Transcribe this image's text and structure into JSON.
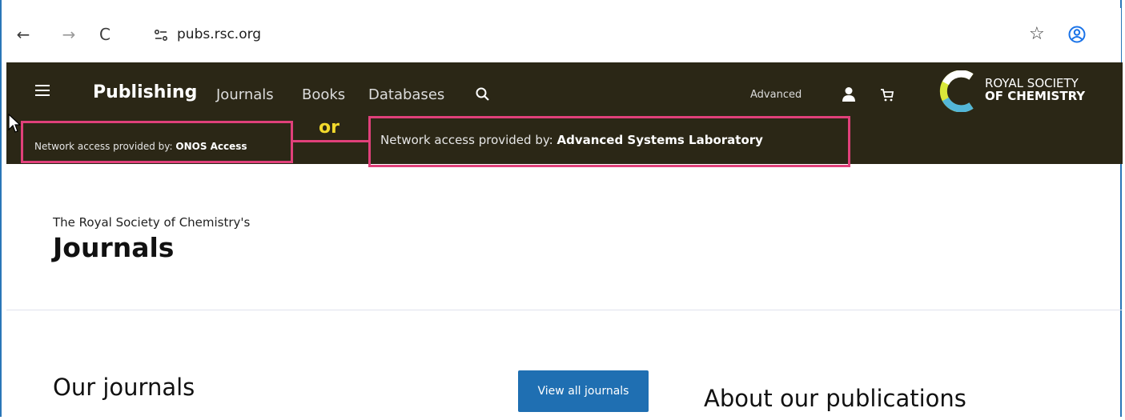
{
  "browser": {
    "back_icon": "arrow-left-icon",
    "forward_icon": "arrow-right-icon",
    "reload_icon": "reload-icon",
    "url": "pubs.rsc.org"
  },
  "header": {
    "brand": "Publishing",
    "nav": [
      "Journals",
      "Books",
      "Databases"
    ],
    "advanced": "Advanced",
    "logo_line1": "ROYAL SOCIETY",
    "logo_line2": "OF CHEMISTRY",
    "background_color": "#2b2716",
    "access_1_prefix": "Network access provided by: ",
    "access_1_name": "ONOS Access",
    "access_2_prefix": "Network access provided by: ",
    "access_2_name": "Advanced Systems Laboratory",
    "or_label": "or",
    "highlight_color": "#e0407a"
  },
  "main": {
    "intro_small": "The Royal Society of Chemistry's",
    "intro_title": "Journals",
    "our_journals": "Our journals",
    "view_all_button": "View all journals",
    "about_heading": "About our publications",
    "button_color": "#1f6fb2"
  }
}
